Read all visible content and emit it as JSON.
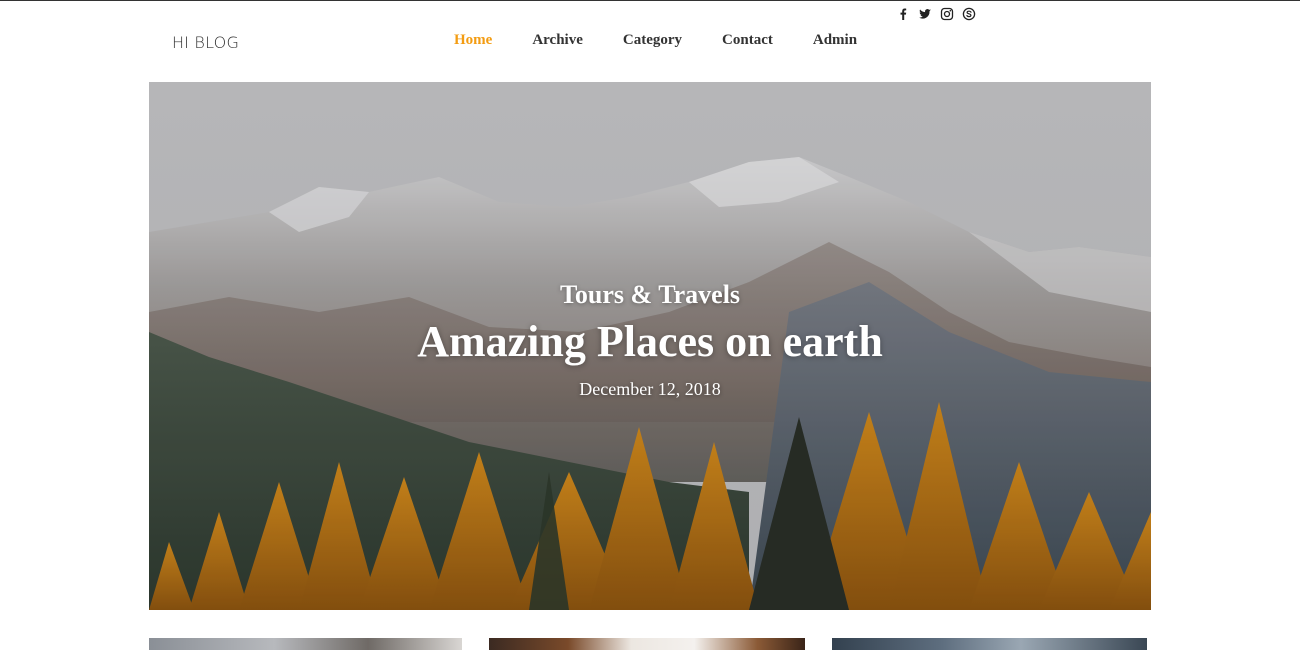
{
  "header": {
    "logo": "HI BLOG",
    "nav": [
      {
        "label": "Home",
        "active": true
      },
      {
        "label": "Archive",
        "active": false
      },
      {
        "label": "Category",
        "active": false
      },
      {
        "label": "Contact",
        "active": false
      },
      {
        "label": "Admin",
        "active": false
      }
    ],
    "social": [
      "facebook-icon",
      "twitter-icon",
      "instagram-icon",
      "skype-icon"
    ]
  },
  "hero": {
    "category": "Tours & Travels",
    "title": "Amazing Places on earth",
    "date": "December 12, 2018"
  },
  "colors": {
    "accent": "#f39c12",
    "text": "#333333"
  }
}
